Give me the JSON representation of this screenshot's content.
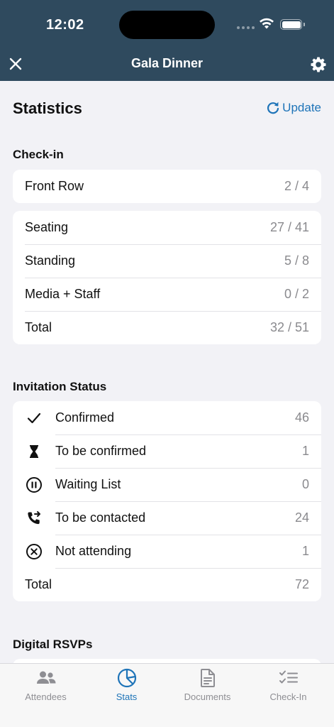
{
  "status_bar": {
    "time": "12:02"
  },
  "nav": {
    "title": "Gala Dinner"
  },
  "page": {
    "title": "Statistics",
    "update_label": "Update"
  },
  "checkin": {
    "label": "Check-in",
    "front_row": {
      "label": "Front Row",
      "value": "2 / 4"
    },
    "rows": [
      {
        "label": "Seating",
        "value": "27 / 41"
      },
      {
        "label": "Standing",
        "value": "5 / 8"
      },
      {
        "label": "Media + Staff",
        "value": "0 / 2"
      },
      {
        "label": "Total",
        "value": "32 / 51"
      }
    ]
  },
  "invitation": {
    "label": "Invitation Status",
    "rows": [
      {
        "icon": "checkmark-icon",
        "label": "Confirmed",
        "value": "46"
      },
      {
        "icon": "hourglass-icon",
        "label": "To be confirmed",
        "value": "1"
      },
      {
        "icon": "pause-circle-icon",
        "label": "Waiting List",
        "value": "0"
      },
      {
        "icon": "phone-forward-icon",
        "label": "To be contacted",
        "value": "24"
      },
      {
        "icon": "x-circle-icon",
        "label": "Not attending",
        "value": "1"
      }
    ],
    "total": {
      "label": "Total",
      "value": "72"
    }
  },
  "digital": {
    "label": "Digital RSVPs"
  },
  "tabs": [
    {
      "label": "Attendees",
      "icon": "people-icon",
      "active": false
    },
    {
      "label": "Stats",
      "icon": "pie-chart-icon",
      "active": true
    },
    {
      "label": "Documents",
      "icon": "document-icon",
      "active": false
    },
    {
      "label": "Check-In",
      "icon": "checklist-icon",
      "active": false
    }
  ],
  "colors": {
    "header": "#2f4a5e",
    "accent": "#1e74b8",
    "background": "#f2f2f6"
  }
}
